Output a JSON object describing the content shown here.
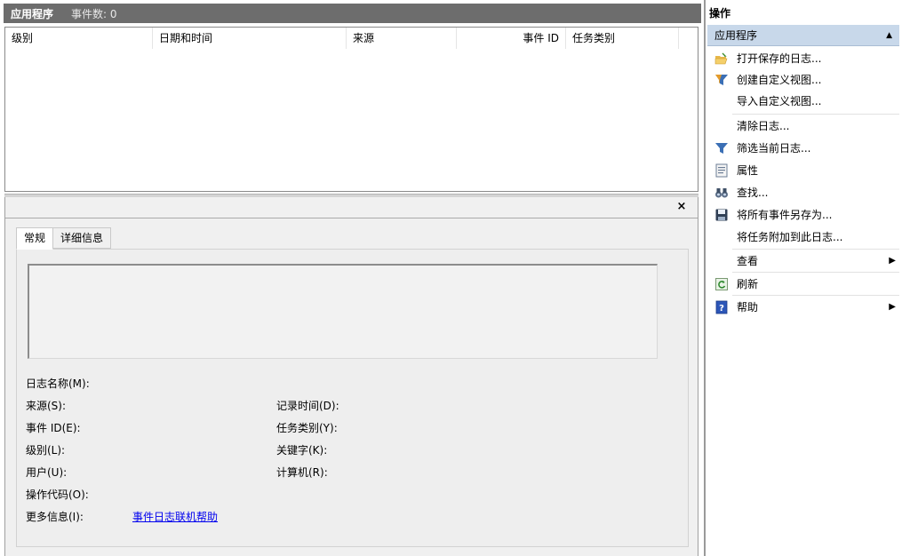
{
  "titlebar": {
    "title": "应用程序",
    "event_count": "事件数: 0"
  },
  "list": {
    "columns": [
      "级别",
      "日期和时间",
      "来源",
      "事件 ID",
      "任务类别"
    ]
  },
  "detail": {
    "close_glyph": "×",
    "tabs": [
      {
        "label": "常规",
        "active": true
      },
      {
        "label": "详细信息",
        "active": false
      }
    ],
    "fields": {
      "log_name": "日志名称(M):",
      "source": "来源(S):",
      "event_id": "事件 ID(E):",
      "level": "级别(L):",
      "user": "用户(U):",
      "opcode": "操作代码(O):",
      "more_info": "更多信息(I):",
      "logged": "记录时间(D):",
      "task_category": "任务类别(Y):",
      "keywords": "关键字(K):",
      "computer": "计算机(R):"
    },
    "help_link": "事件日志联机帮助"
  },
  "actions": {
    "header": "操作",
    "group": "应用程序",
    "items": [
      {
        "label": "打开保存的日志...",
        "icon": "folder-open-icon"
      },
      {
        "label": "创建自定义视图...",
        "icon": "filter-icon"
      },
      {
        "label": "导入自定义视图...",
        "icon": ""
      },
      {
        "label": "清除日志...",
        "icon": ""
      },
      {
        "label": "筛选当前日志...",
        "icon": "filter-icon"
      },
      {
        "label": "属性",
        "icon": "properties-icon"
      },
      {
        "label": "查找...",
        "icon": "binoculars-icon"
      },
      {
        "label": "将所有事件另存为...",
        "icon": "save-icon"
      },
      {
        "label": "将任务附加到此日志...",
        "icon": ""
      },
      {
        "label": "查看",
        "icon": ""
      },
      {
        "label": "刷新",
        "icon": "refresh-icon"
      },
      {
        "label": "帮助",
        "icon": "help-icon"
      }
    ]
  },
  "colors": {
    "titlebar_bg": "#6d6d6d",
    "group_bg": "#c8d8ea",
    "link": "#0000ee"
  }
}
